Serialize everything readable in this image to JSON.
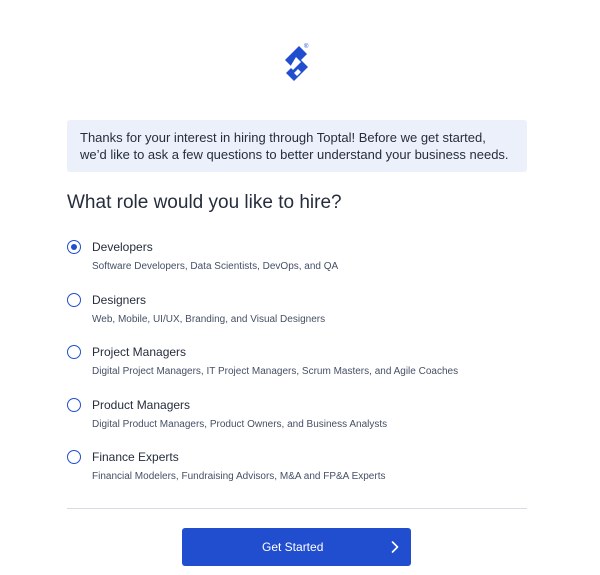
{
  "brand": {
    "logo_icon": "toptal-logo-icon",
    "registered_mark": "®",
    "color": "#204ecf"
  },
  "intro": {
    "text": "Thanks for your interest in hiring through Toptal! Before we get started, we’d like to ask a few questions to better understand your business needs."
  },
  "question": {
    "title": "What role would you like to hire?"
  },
  "options": [
    {
      "title": "Developers",
      "description": "Software Developers, Data Scientists, DevOps, and QA",
      "checked": true
    },
    {
      "title": "Designers",
      "description": "Web, Mobile, UI/UX, Branding, and Visual Designers",
      "checked": false
    },
    {
      "title": "Project Managers",
      "description": "Digital Project Managers, IT Project Managers, Scrum Masters, and Agile Coaches",
      "checked": false
    },
    {
      "title": "Product Managers",
      "description": "Digital Product Managers, Product Owners, and Business Analysts",
      "checked": false
    },
    {
      "title": "Finance Experts",
      "description": "Financial Modelers, Fundraising Advisors, M&A and FP&A Experts",
      "checked": false
    }
  ],
  "cta": {
    "label": "Get Started",
    "icon": "chevron-right-icon"
  }
}
